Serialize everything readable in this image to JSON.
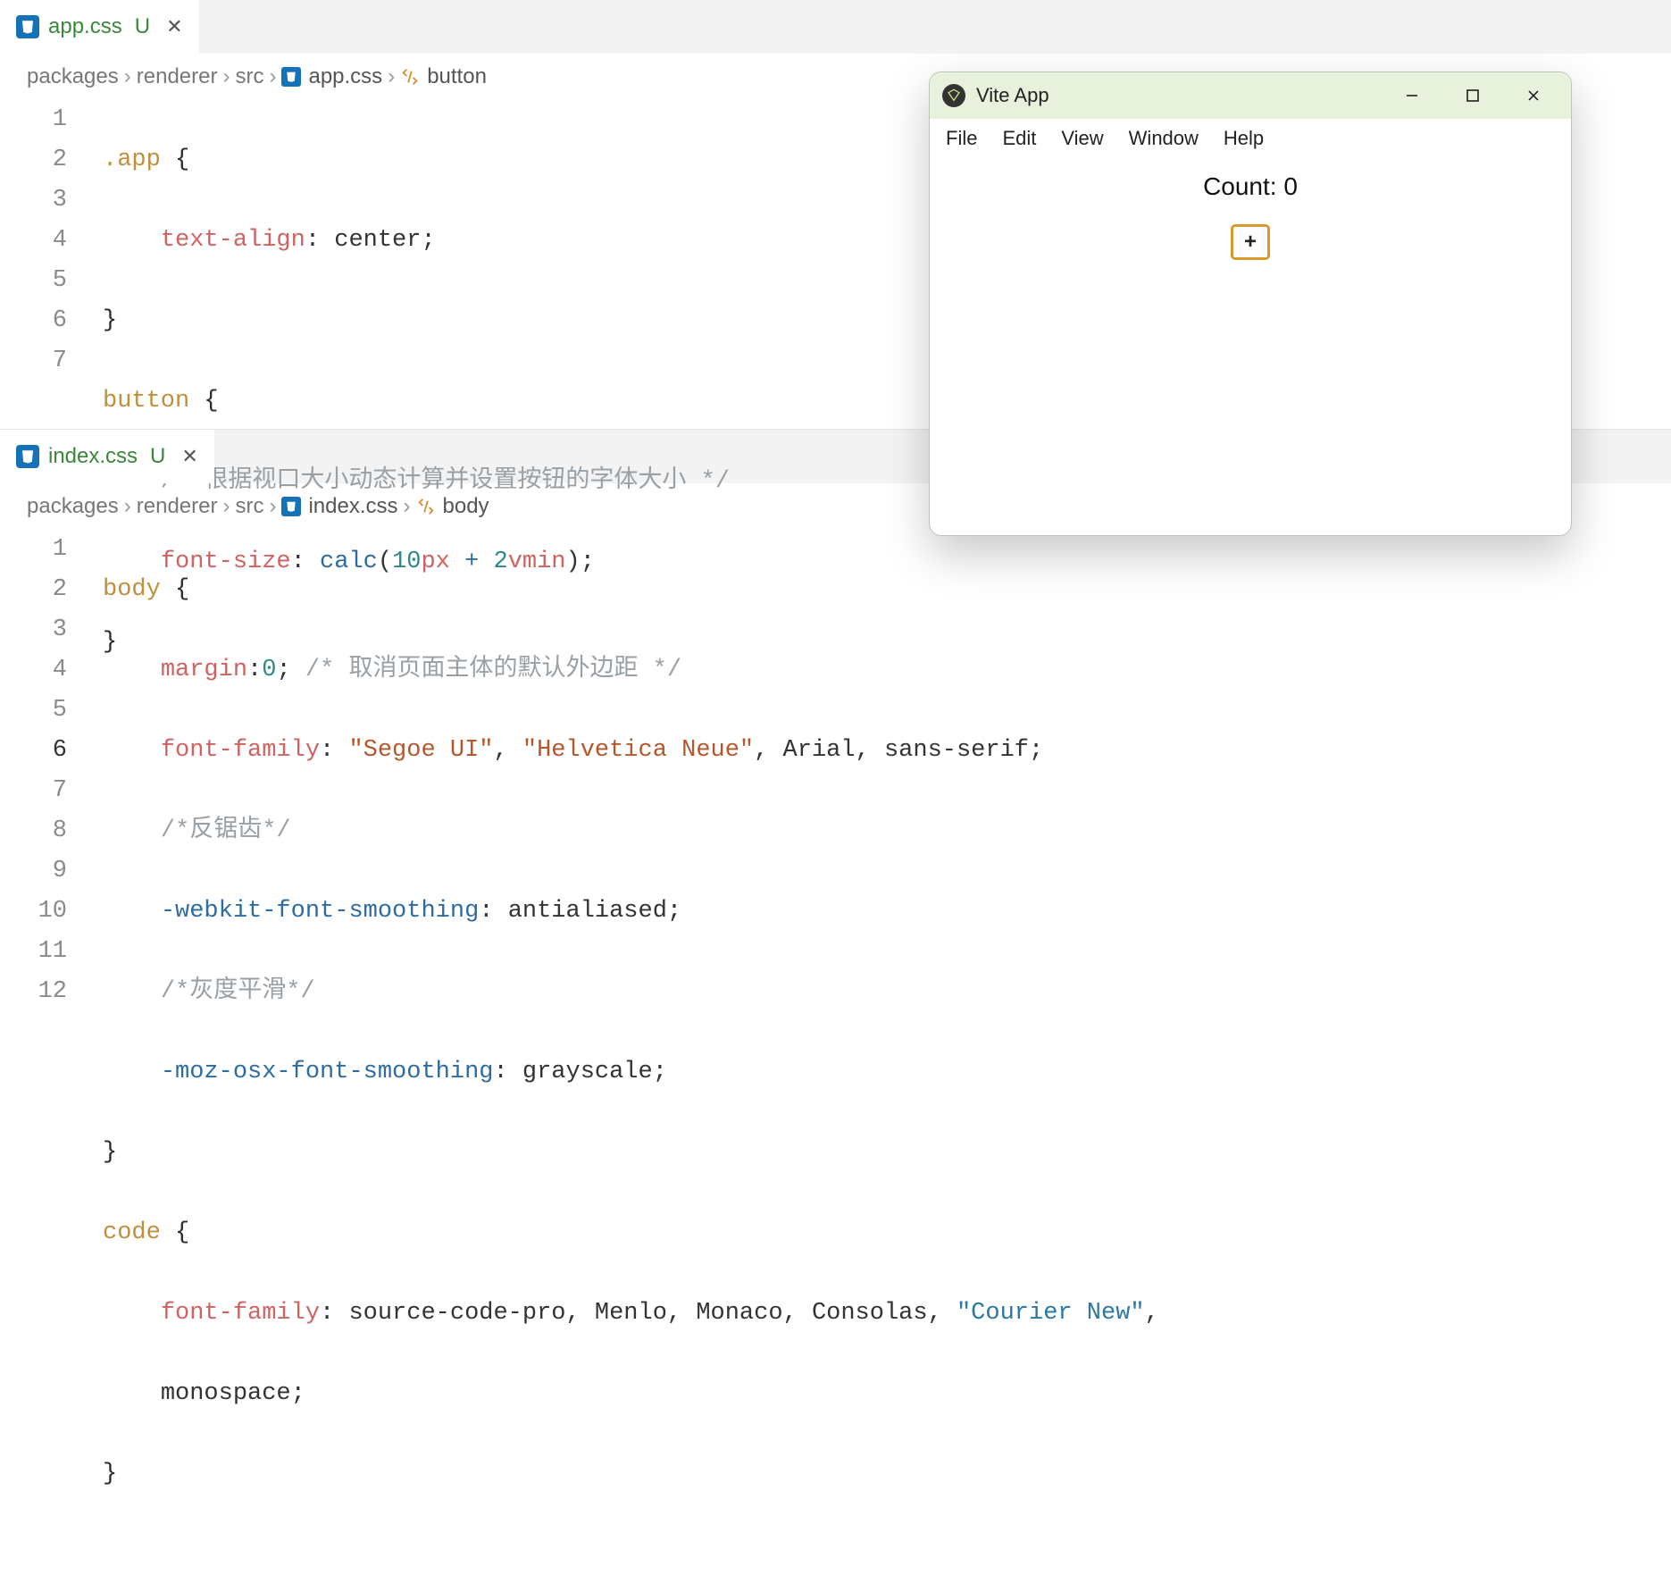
{
  "panes": [
    {
      "tab": {
        "filename": "app.css",
        "git": "U"
      },
      "crumb": {
        "segs": [
          "packages",
          "renderer",
          "src"
        ],
        "file": "app.css",
        "symbol": "button"
      },
      "lines": [
        1,
        2,
        3,
        4,
        5,
        6,
        7
      ],
      "active_line": null,
      "code": {
        "l1": {
          "sel": ".app",
          "brace": "{"
        },
        "l2": {
          "prop": "text-align",
          "val": "center"
        },
        "l3": {
          "brace": "}"
        },
        "l4": {
          "sel": "button",
          "brace": "{"
        },
        "l5": {
          "cmt": "/* 根据视口大小动态计算并设置按钮的字体大小 */"
        },
        "l6": {
          "prop": "font-size",
          "fn": "calc",
          "n1": "10",
          "u1": "px",
          "op": "+",
          "n2": "2",
          "u2": "vmin"
        },
        "l7": {
          "brace": "}"
        }
      }
    },
    {
      "tab": {
        "filename": "index.css",
        "git": "U"
      },
      "crumb": {
        "segs": [
          "packages",
          "renderer",
          "src"
        ],
        "file": "index.css",
        "symbol": "body"
      },
      "lines": [
        1,
        2,
        3,
        4,
        5,
        6,
        7,
        8,
        9,
        10,
        11,
        12
      ],
      "active_line": 6,
      "code": {
        "l1": {
          "sel": "body",
          "brace": "{"
        },
        "l2": {
          "prop": "margin",
          "num": "0",
          "cmt": "/* 取消页面主体的默认外边距 */"
        },
        "l3": {
          "prop": "font-family",
          "s1": "\"Segoe UI\"",
          "s2": "\"Helvetica Neue\"",
          "i1": "Arial",
          "i2": "sans-serif"
        },
        "l4": {
          "cmt": "/*反锯齿*/"
        },
        "l5": {
          "prop": "-webkit-font-smoothing",
          "val": "antialiased"
        },
        "l6": {
          "cmt": "/*灰度平滑*/"
        },
        "l7": {
          "prop": "-moz-osx-font-smoothing",
          "val": "grayscale"
        },
        "l8": {
          "brace": "}"
        },
        "l9": {
          "sel": "code",
          "brace": "{"
        },
        "l10": {
          "prop": "font-family",
          "i1": "source-code-pro",
          "i2": "Menlo",
          "i3": "Monaco",
          "i4": "Consolas",
          "s1": "\"Courier New\"",
          "tail": ","
        },
        "l11": {
          "val": "monospace"
        },
        "l12": {
          "brace": "}"
        }
      }
    }
  ],
  "appwin": {
    "title": "Vite App",
    "menus": [
      "File",
      "Edit",
      "View",
      "Window",
      "Help"
    ],
    "count_label": "Count: 0",
    "plus": "+"
  }
}
